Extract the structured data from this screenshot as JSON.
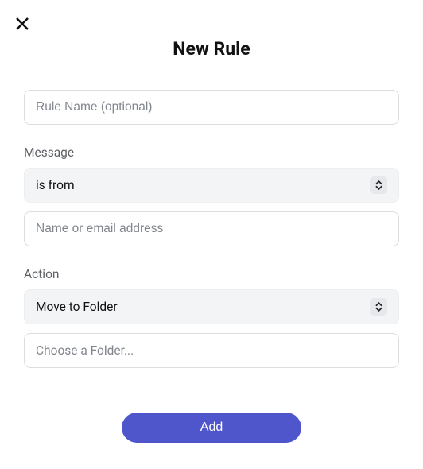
{
  "title": "New Rule",
  "ruleName": {
    "value": "",
    "placeholder": "Rule Name (optional)"
  },
  "sections": {
    "message": {
      "label": "Message",
      "conditionSelect": {
        "value": "is from"
      },
      "fromInput": {
        "value": "",
        "placeholder": "Name or email address"
      }
    },
    "action": {
      "label": "Action",
      "actionSelect": {
        "value": "Move to Folder"
      },
      "folderSelect": {
        "placeholder": "Choose a Folder..."
      }
    }
  },
  "buttons": {
    "add": "Add"
  }
}
